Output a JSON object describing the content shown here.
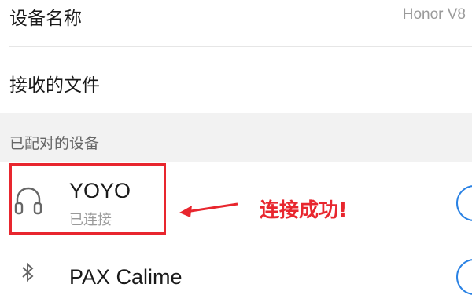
{
  "device_name": {
    "label": "设备名称",
    "value": "Honor V8"
  },
  "received_files": {
    "label": "接收的文件"
  },
  "paired_section": {
    "title": "已配对的设备"
  },
  "paired_devices": [
    {
      "name": "YOYO",
      "status": "已连接",
      "icon": "headset-icon"
    },
    {
      "name": "PAX Calime",
      "icon": "bluetooth-icon"
    }
  ],
  "annotation": {
    "text": "连接成功!",
    "color": "#e8262e"
  },
  "colors": {
    "accent": "#2a82e4",
    "highlight": "#e8262e"
  }
}
